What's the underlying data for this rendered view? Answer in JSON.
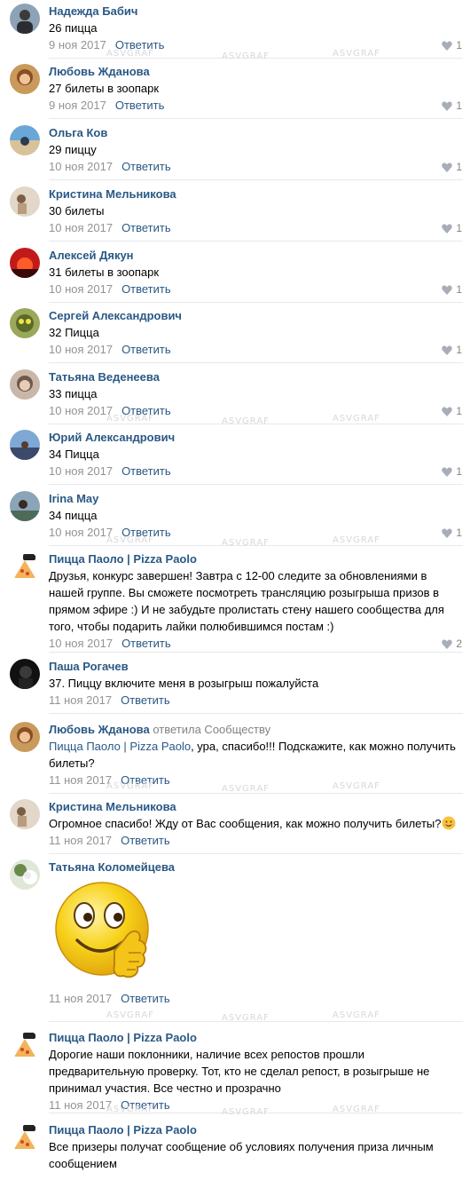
{
  "reply_label": "Ответить",
  "watermark": "ASVGRAF",
  "comments": [
    {
      "author": "Надежда Бабич",
      "text": "26 пицца",
      "date": "9 ноя 2017",
      "likes": "1"
    },
    {
      "author": "Любовь Жданова",
      "text": "27 билеты в зоопарк",
      "date": "9 ноя 2017",
      "likes": "1"
    },
    {
      "author": "Ольга Ков",
      "text": "29 пиццу",
      "date": "10 ноя 2017",
      "likes": "1"
    },
    {
      "author": "Кристина Мельникова",
      "text": "30 билеты",
      "date": "10 ноя 2017",
      "likes": "1"
    },
    {
      "author": "Алексей Дякун",
      "text": "31 билеты в зоопарк",
      "date": "10 ноя 2017",
      "likes": "1"
    },
    {
      "author": "Сергей Александрович",
      "text": "32 Пицца",
      "date": "10 ноя 2017",
      "likes": "1"
    },
    {
      "author": "Татьяна Веденеева",
      "text": "33 пицца",
      "date": "10 ноя 2017",
      "likes": "1"
    },
    {
      "author": "Юрий Александрович",
      "text": "34 Пицца",
      "date": "10 ноя 2017",
      "likes": "1"
    },
    {
      "author": "Irina May",
      "text": "34 пицца",
      "date": "10 ноя 2017",
      "likes": "1"
    },
    {
      "author": "Пицца Паоло | Pizza Paolo",
      "text_lines": [
        "Друзья, конкурс завершен! Завтра с 12-00 следите за обновлениями в",
        "нашей группе. Вы сможете посмотреть трансляцию розыгрыша призов в",
        "прямом эфире :) И не забудьте пролистать стену нашего сообщества для",
        "того, чтобы подарить лайки полюбившимся постам :)"
      ],
      "date": "10 ноя 2017",
      "likes": "2"
    },
    {
      "author": "Паша Рогачев",
      "text": "37. Пиццу включите меня в розыгрыш пожалуйста",
      "date": "11 ноя 2017"
    },
    {
      "author": "Любовь Жданова",
      "replied": "ответила Сообществу",
      "reply_to": "Пицца Паоло | Pizza Paolo",
      "text_after": ", ура, спасибо!!! Подскажите, как можно получить",
      "text_line2": "билеты?",
      "date": "11 ноя 2017"
    },
    {
      "author": "Кристина Мельникова",
      "text": "Огромное спасибо! Жду от Вас сообщения, как можно получить билеты?",
      "date": "11 ноя 2017"
    },
    {
      "author": "Татьяна Коломейцева",
      "date": "11 ноя 2017"
    },
    {
      "author": "Пицца Паоло | Pizza Paolo",
      "text_lines": [
        "Дорогие наши поклонники, наличие всех репостов прошли",
        "предварительную проверку. Тот, кто не сделал репост, в розыгрыше не",
        "принимал участия. Все честно и прозрачно"
      ],
      "date": "11 ноя 2017"
    },
    {
      "author": "Пицца Паоло | Pizza Paolo",
      "text_lines": [
        "Все призеры получат сообщение об условиях получения приза личным",
        "сообщением"
      ]
    }
  ]
}
